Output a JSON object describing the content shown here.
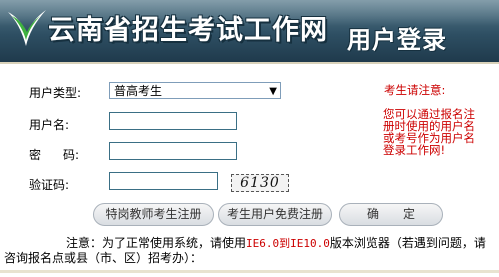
{
  "header": {
    "site_title": "云南省招生考试工作网",
    "login_title": "用户登录"
  },
  "form": {
    "user_type_label": "用户类型:",
    "user_type_value": "普高考生",
    "username_label": "用户名:",
    "password_label_1": "密",
    "password_label_2": "码:",
    "captcha_label": "验证码:",
    "captcha_value": "6130"
  },
  "buttons": {
    "teacher_register": "特岗教师考生注册",
    "free_register": "考生用户免费注册",
    "confirm": "确　　定"
  },
  "notice": {
    "heading": "考生请注意:",
    "body": "您可以通过报名注册时使用的用户名或考号作为用户名登录工作网!"
  },
  "footer": {
    "prefix": "注意：为了正常使用系统，请使用",
    "browser_range": "IE6.0到IE10.0",
    "suffix": "版本浏览器（若遇到问题，请咨询报名点或县（市、区）招考办）："
  },
  "colors": {
    "banner": "#2e4f63",
    "notice_red": "#cc0000",
    "input_border": "#3a6f85"
  }
}
